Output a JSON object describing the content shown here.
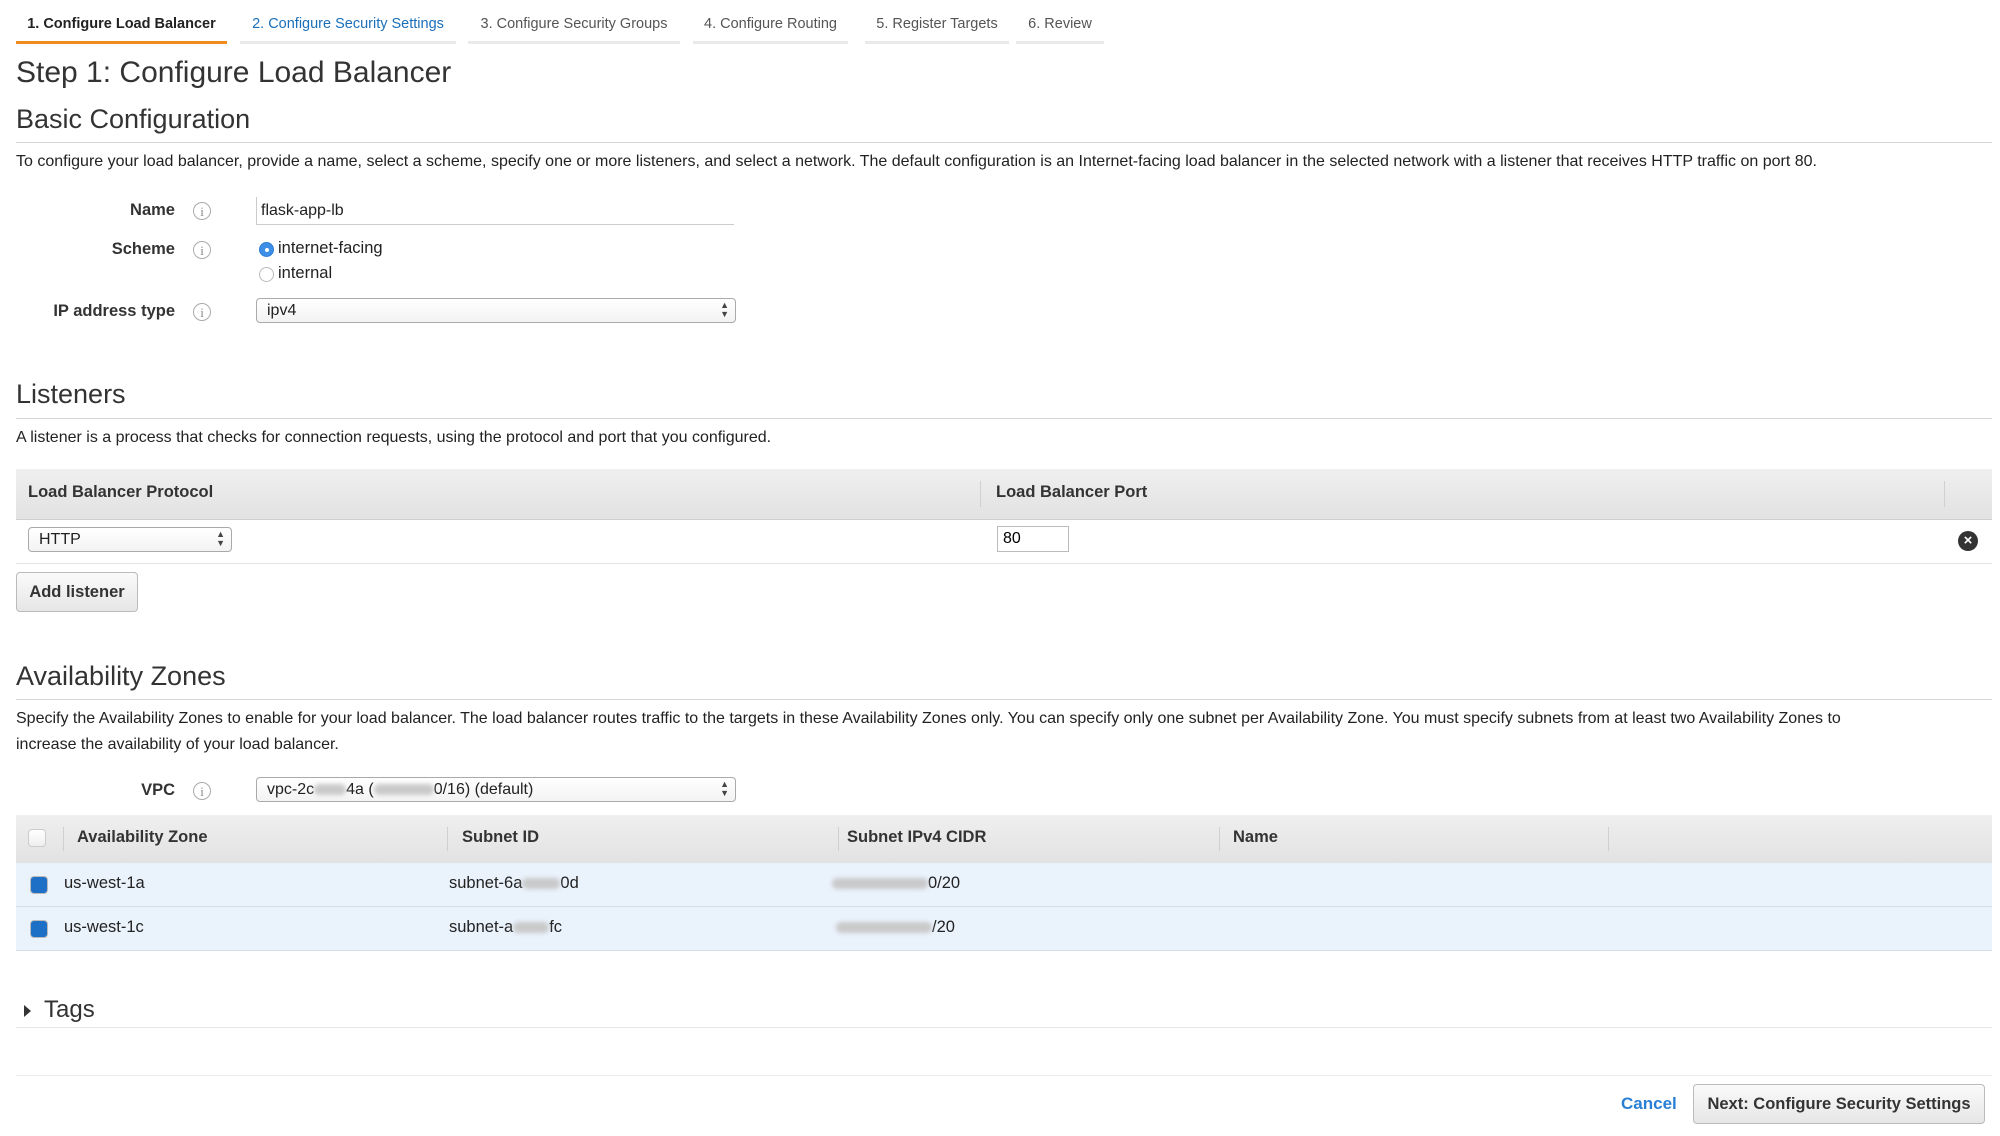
{
  "wizard": {
    "tabs": [
      {
        "label": "1. Configure Load Balancer",
        "state": "active"
      },
      {
        "label": "2. Configure Security Settings",
        "state": "link"
      },
      {
        "label": "3. Configure Security Groups",
        "state": "inactive"
      },
      {
        "label": "4. Configure Routing",
        "state": "inactive"
      },
      {
        "label": "5. Register Targets",
        "state": "inactive"
      },
      {
        "label": "6. Review",
        "state": "inactive"
      }
    ],
    "accent_color": "#f08b1d"
  },
  "page_title": "Step 1: Configure Load Balancer",
  "basic": {
    "heading": "Basic Configuration",
    "description": "To configure your load balancer, provide a name, select a scheme, specify one or more listeners, and select a network. The default configuration is an Internet-facing load balancer in the selected network with a listener that receives HTTP traffic on port 80.",
    "name_label": "Name",
    "name_value": "flask-app-lb",
    "scheme_label": "Scheme",
    "scheme_options": [
      "internet-facing",
      "internal"
    ],
    "scheme_selected": "internet-facing",
    "ip_label": "IP address type",
    "ip_value": "ipv4",
    "info_icon": "i"
  },
  "listeners": {
    "heading": "Listeners",
    "description": "A listener is a process that checks for connection requests, using the protocol and port that you configured.",
    "columns": [
      "Load Balancer Protocol",
      "Load Balancer Port"
    ],
    "rows": [
      {
        "protocol": "HTTP",
        "port": "80"
      }
    ],
    "remove_icon": "×",
    "add_label": "Add listener"
  },
  "az": {
    "heading": "Availability Zones",
    "description_line1": "Specify the Availability Zones to enable for your load balancer. The load balancer routes traffic to the targets in these Availability Zones only. You can specify only one subnet per Availability Zone. You must specify subnets from at least two Availability Zones to",
    "description_line2": "increase the availability of your load balancer.",
    "vpc_label": "VPC",
    "vpc_prefix": "vpc-2c",
    "vpc_mid": "4a (",
    "vpc_suffix": "0/16) (default)",
    "columns": [
      "Availability Zone",
      "Subnet ID",
      "Subnet IPv4 CIDR",
      "Name"
    ],
    "rows": [
      {
        "zone": "us-west-1a",
        "subnet_prefix": "subnet-6a",
        "subnet_suffix": "0d",
        "cidr_suffix": "0/20",
        "name": "",
        "checked": true
      },
      {
        "zone": "us-west-1c",
        "subnet_prefix": "subnet-a",
        "subnet_suffix": "fc",
        "cidr_suffix": "/20",
        "name": "",
        "checked": true
      }
    ]
  },
  "tags": {
    "heading": "Tags",
    "expanded": false
  },
  "footer": {
    "cancel_label": "Cancel",
    "next_label": "Next: Configure Security Settings"
  }
}
